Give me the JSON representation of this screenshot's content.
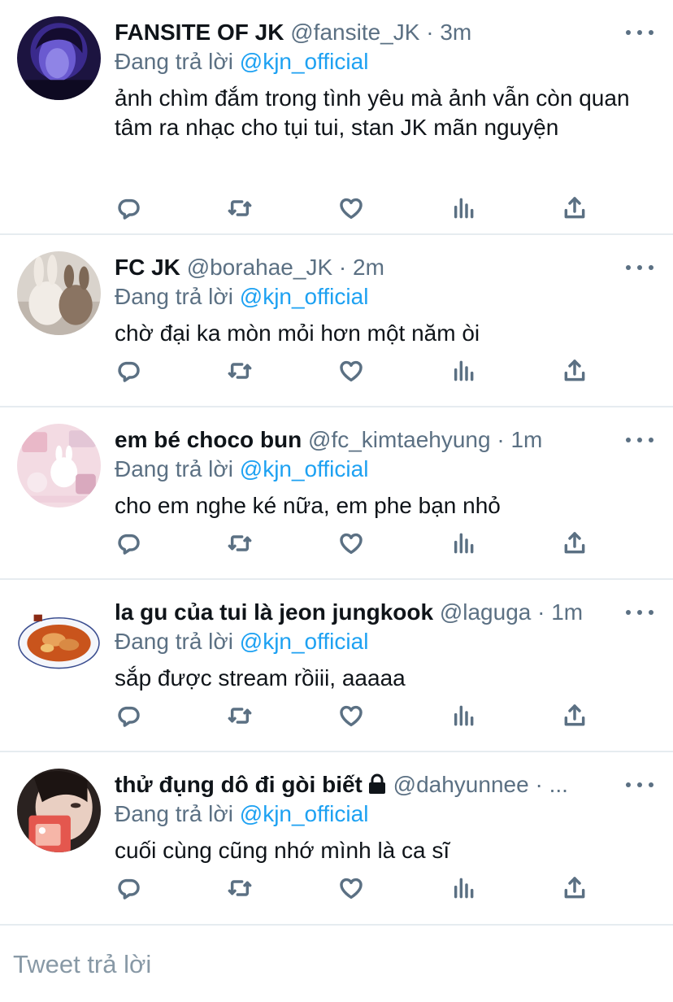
{
  "reply_prefix": "Đang trả lời",
  "mention": "@kjn_official",
  "tweets": [
    {
      "name": "FANSITE OF JK",
      "handle": "@fansite_JK",
      "separator": "·",
      "time": "3m",
      "text": "ảnh chìm đắm trong tình yêu mà ảnh vẫn còn quan tâm ra nhạc cho tụi tui, stan JK mãn nguyện"
    },
    {
      "name": "FC JK",
      "handle": "@borahae_JK",
      "separator": "·",
      "time": "2m",
      "text": "chờ đại ka mòn mỏi hơn một năm òi"
    },
    {
      "name": "em bé choco bun",
      "handle": "@fc_kimtaehyung",
      "separator": "·",
      "time": "1m",
      "text": "cho em nghe ké nữa, em phe bạn nhỏ"
    },
    {
      "name": "la gu của tui là jeon jungkook",
      "handle": "@laguga",
      "separator": "·",
      "time": "1m",
      "text": "sắp được stream rồiii, aaaaa"
    },
    {
      "name": "thử đụng dô đi gòi biết",
      "handle": "@dahyunnee",
      "separator": "·",
      "time": "...",
      "text": "cuối cùng cũng nhớ mình là ca sĩ"
    }
  ],
  "compose": {
    "placeholder": "Tweet trả lời"
  },
  "colors": {
    "link": "#1da1f2",
    "secondary_text": "#5b7083",
    "divider": "#e6ecf0"
  },
  "icons": [
    "reply-icon",
    "retweet-icon",
    "like-icon",
    "analytics-icon",
    "share-icon",
    "more-icon",
    "lock-icon"
  ]
}
